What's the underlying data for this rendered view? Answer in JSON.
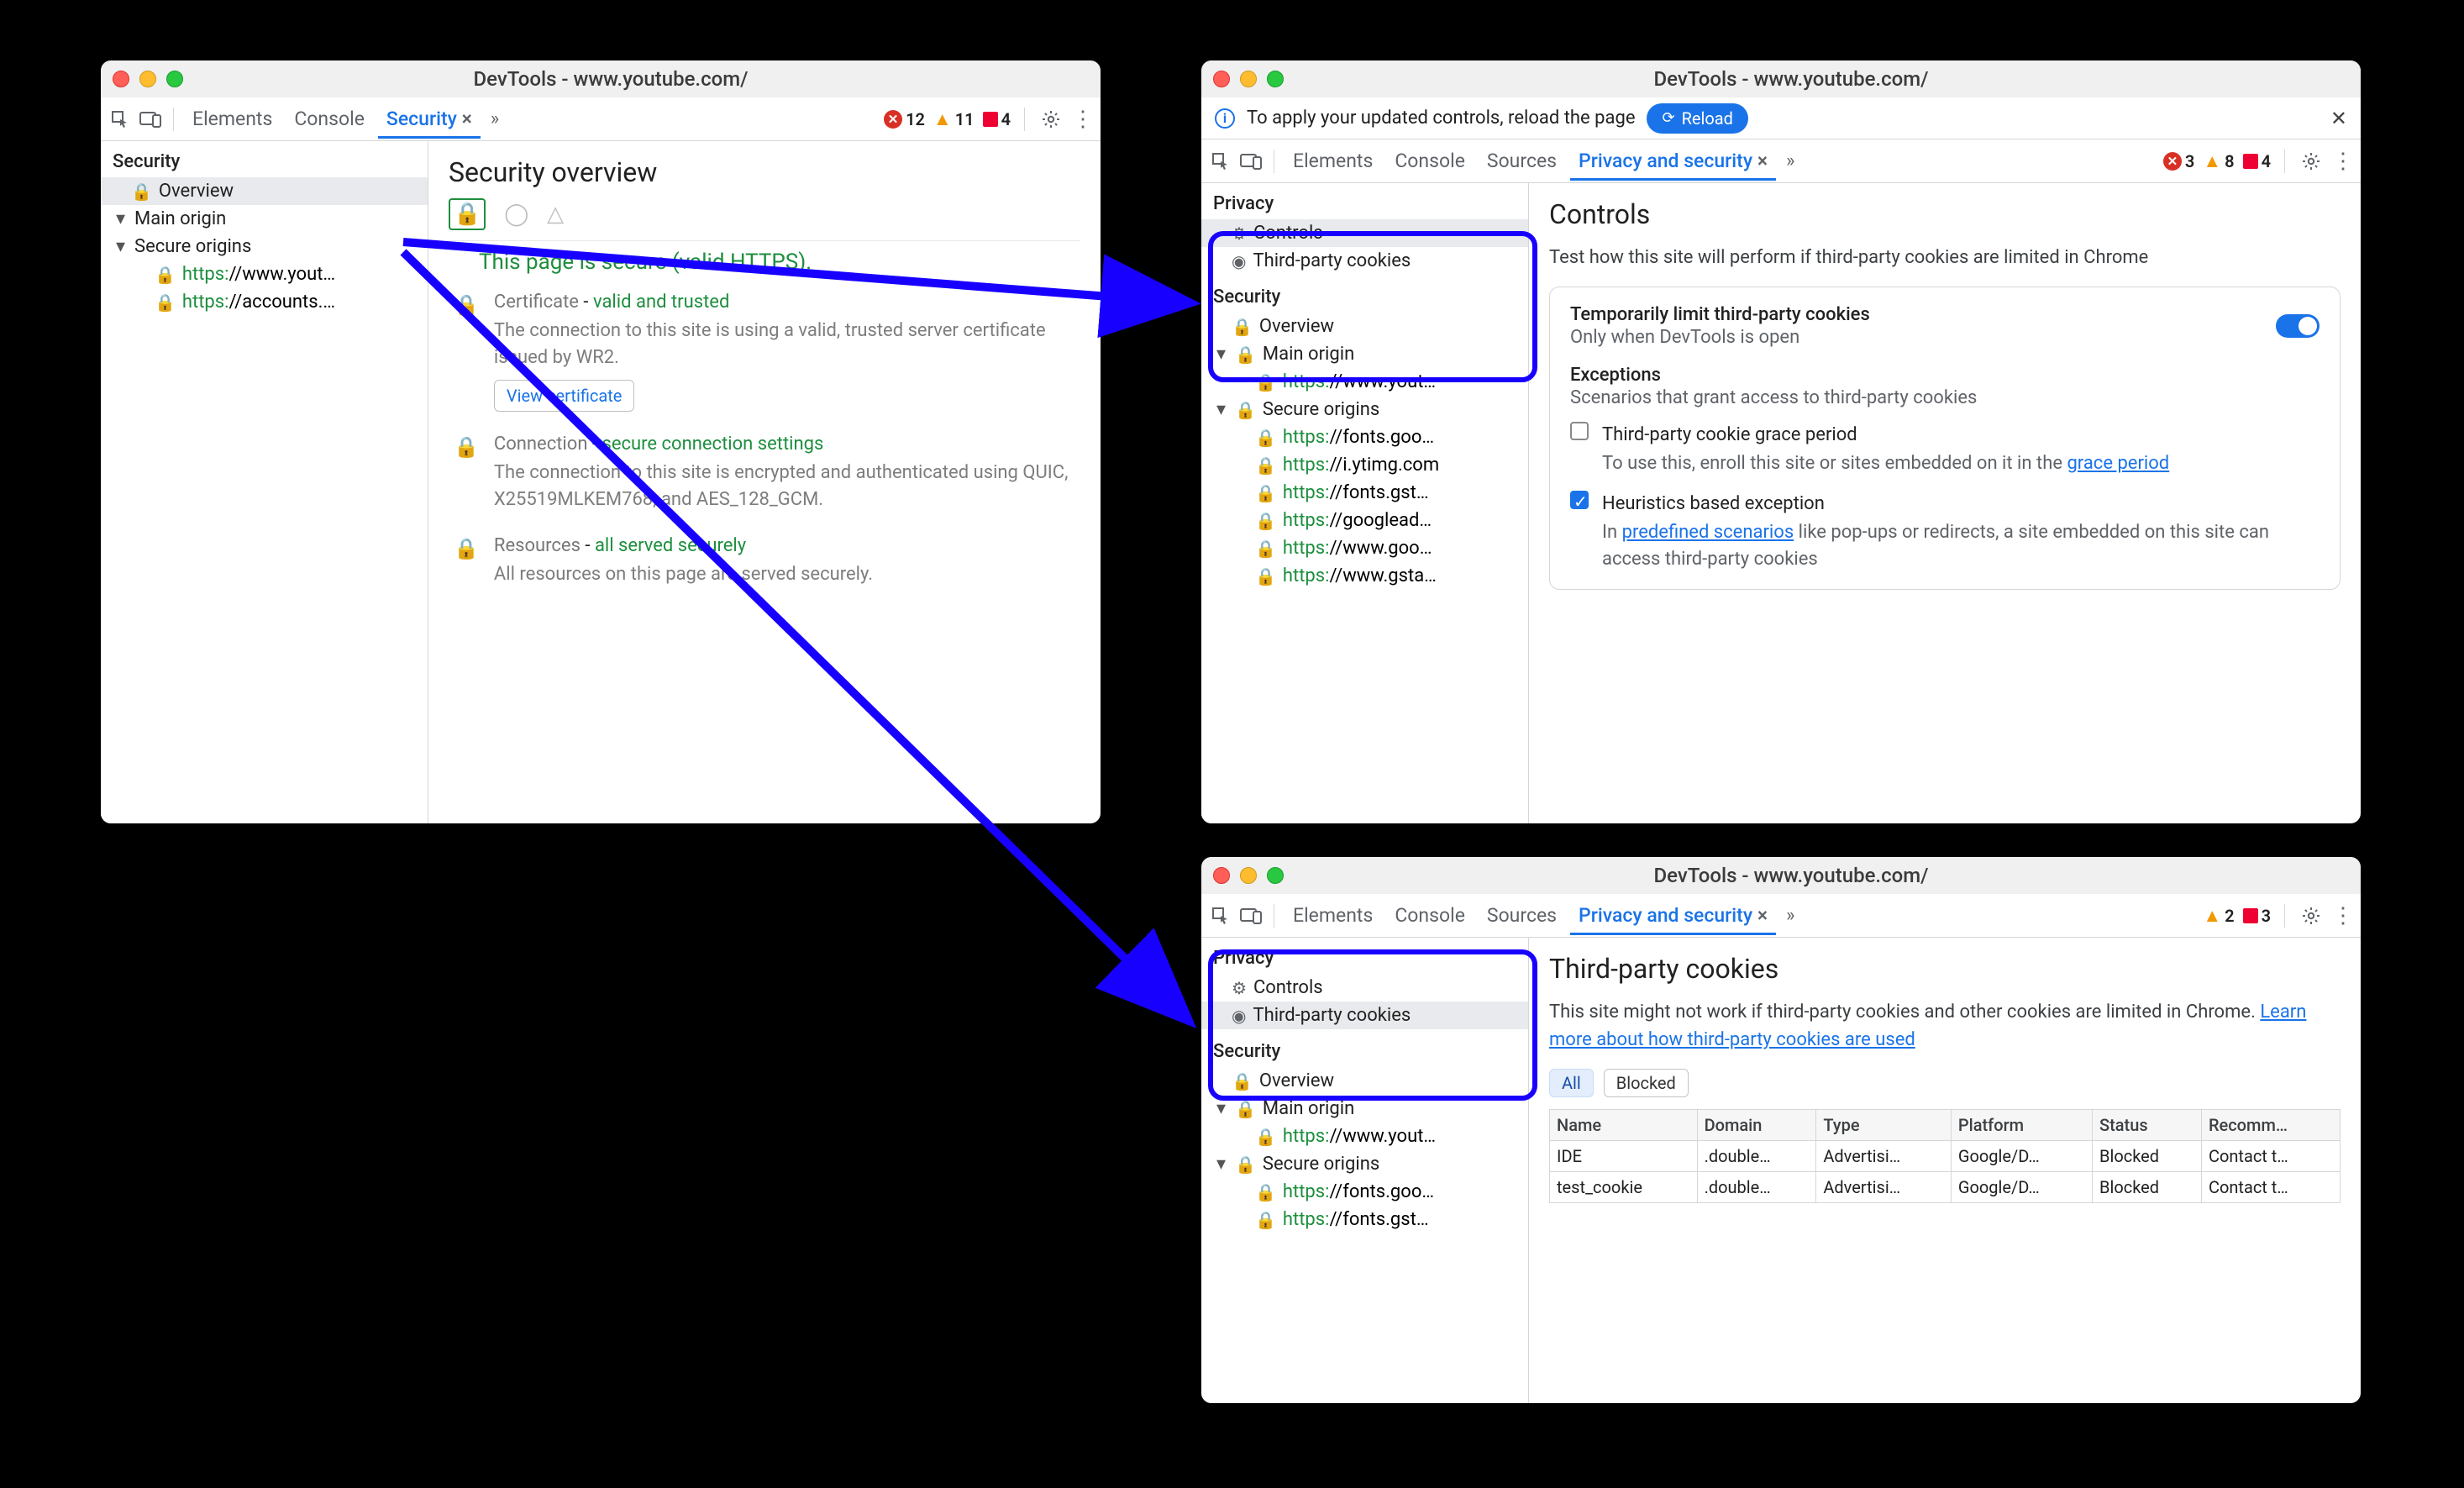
{
  "colors": {
    "accent": "#1a73e8",
    "secure_green": "#1e8e3e",
    "error_red": "#d93025",
    "warning_orange": "#f29900",
    "highlight_blue": "#1800ff"
  },
  "window_a": {
    "title": "DevTools - www.youtube.com/",
    "toolbar": {
      "tabs": {
        "elements": "Elements",
        "console": "Console",
        "security": "Security"
      },
      "counters": {
        "errors": 12,
        "warnings": 11,
        "issues": 4
      }
    },
    "sidebar": {
      "heading_security": "Security",
      "overview": "Overview",
      "main_origin": "Main origin",
      "secure_origins": "Secure origins",
      "origins": [
        "https://www.yout…",
        "https://accounts.…"
      ]
    },
    "content": {
      "title": "Security overview",
      "page_secure": "This page is secure (valid HTTPS).",
      "cert_label": "Certificate",
      "cert_status": "valid and trusted",
      "cert_desc": "The connection to this site is using a valid, trusted server certificate issued by WR2.",
      "view_cert": "View certificate",
      "conn_label": "Connection",
      "conn_status": "secure connection settings",
      "conn_desc": "The connection to this site is encrypted and authenticated using QUIC, X25519MLKEM768, and AES_128_GCM.",
      "res_label": "Resources",
      "res_status": "all served securely",
      "res_desc": "All resources on this page are served securely."
    }
  },
  "window_b": {
    "title": "DevTools - www.youtube.com/",
    "banner": {
      "text": "To apply your updated controls, reload the page",
      "button": "Reload"
    },
    "toolbar": {
      "tabs": {
        "elements": "Elements",
        "console": "Console",
        "sources": "Sources",
        "privsec": "Privacy and security"
      },
      "counters": {
        "errors": 3,
        "warnings": 8,
        "issues": 4
      }
    },
    "sidebar": {
      "heading_privacy": "Privacy",
      "controls": "Controls",
      "third_party": "Third-party cookies",
      "heading_security": "Security",
      "overview": "Overview",
      "main_origin": "Main origin",
      "main_origin_url": "https://www.yout…",
      "secure_origins": "Secure origins",
      "origins": [
        "https://fonts.goo…",
        "https://i.ytimg.com",
        "https://fonts.gst…",
        "https://googlead…",
        "https://www.goo…",
        "https://www.gsta…"
      ]
    },
    "content": {
      "title": "Controls",
      "subtitle": "Test how this site will perform if third-party cookies are limited in Chrome",
      "card_title": "Temporarily limit third-party cookies",
      "card_sub": "Only when DevTools is open",
      "exceptions_heading": "Exceptions",
      "exceptions_desc": "Scenarios that grant access to third-party cookies",
      "exc1_title": "Third-party cookie grace period",
      "exc1_body_pre": "To use this, enroll this site or sites embedded on it in the ",
      "exc1_link": "grace period",
      "exc2_title": "Heuristics based exception",
      "exc2_body_pre": "In ",
      "exc2_link": "predefined scenarios",
      "exc2_body_post": " like pop-ups or redirects, a site embedded on this site can access third-party cookies"
    }
  },
  "window_c": {
    "title": "DevTools - www.youtube.com/",
    "toolbar": {
      "tabs": {
        "elements": "Elements",
        "console": "Console",
        "sources": "Sources",
        "privsec": "Privacy and security"
      },
      "counters": {
        "warnings": 2,
        "issues": 3
      }
    },
    "sidebar": {
      "heading_privacy": "Privacy",
      "controls": "Controls",
      "third_party": "Third-party cookies",
      "heading_security": "Security",
      "overview": "Overview",
      "main_origin": "Main origin",
      "main_origin_url": "https://www.yout…",
      "secure_origins": "Secure origins",
      "origins": [
        "https://fonts.goo…",
        "https://fonts.gst…"
      ]
    },
    "content": {
      "title": "Third-party cookies",
      "subtitle_pre": "This site might not work if third-party cookies and other cookies are limited in Chrome. ",
      "subtitle_link": "Learn more about how third-party cookies are used",
      "filters": {
        "all": "All",
        "blocked": "Blocked"
      },
      "columns": [
        "Name",
        "Domain",
        "Type",
        "Platform",
        "Status",
        "Recomm…"
      ],
      "rows": [
        {
          "name": "IDE",
          "domain": ".double…",
          "type": "Advertisi…",
          "platform": "Google/D…",
          "status": "Blocked",
          "recommendation": "Contact t…"
        },
        {
          "name": "test_cookie",
          "domain": ".double…",
          "type": "Advertisi…",
          "platform": "Google/D…",
          "status": "Blocked",
          "recommendation": "Contact t…"
        }
      ]
    }
  }
}
